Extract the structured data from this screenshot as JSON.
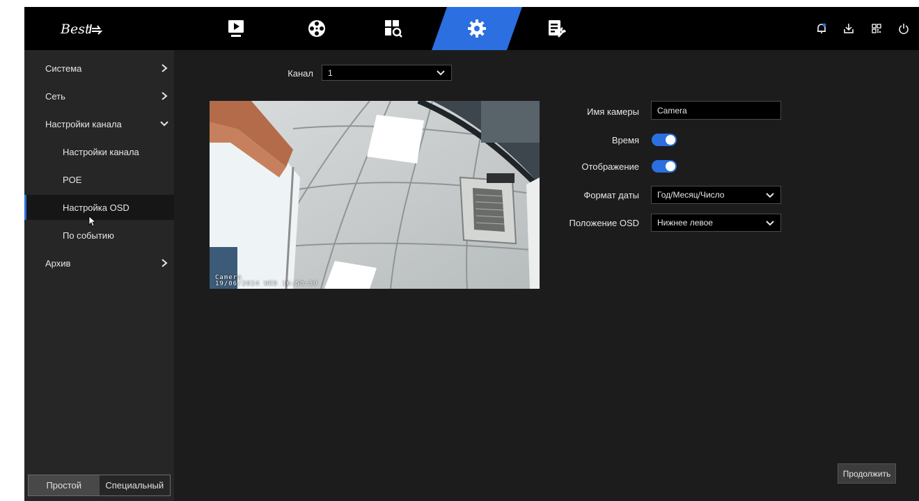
{
  "brand": {
    "logo_text": "Best"
  },
  "topnav": {
    "items": [
      {
        "name": "playback",
        "icon": "play-icon"
      },
      {
        "name": "camera",
        "icon": "film-reel-icon"
      },
      {
        "name": "search",
        "icon": "grid-search-icon"
      },
      {
        "name": "settings",
        "icon": "gear-icon",
        "active": true
      },
      {
        "name": "maintenance",
        "icon": "document-wrench-icon"
      }
    ],
    "right_icons": [
      "alarm-bell-icon",
      "download-icon",
      "qr-code-icon",
      "power-icon"
    ],
    "accent_color": "#2b6fe0"
  },
  "sidebar": {
    "items": [
      {
        "label": "Система",
        "level": 1,
        "expanded": false
      },
      {
        "label": "Сеть",
        "level": 1,
        "expanded": false
      },
      {
        "label": "Настройки канала",
        "level": 1,
        "expanded": true
      },
      {
        "label": "Настройки канала",
        "level": 2
      },
      {
        "label": "POE",
        "level": 2
      },
      {
        "label": "Настройка OSD",
        "level": 2,
        "active": true
      },
      {
        "label": "По событию",
        "level": 2
      },
      {
        "label": "Архив",
        "level": 1,
        "expanded": false
      }
    ],
    "mode": {
      "simple": "Простой",
      "advanced": "Специальный",
      "selected": "simple"
    }
  },
  "main": {
    "channel": {
      "label": "Канал",
      "value": "1"
    },
    "preview": {
      "osd_name": "Camera",
      "osd_datetime": "19/06/2024 WED 16:50:59"
    },
    "form": {
      "camera_name": {
        "label": "Имя камеры",
        "value": "Camera"
      },
      "time": {
        "label": "Время",
        "enabled": true
      },
      "display": {
        "label": "Отображение",
        "enabled": true
      },
      "date_format": {
        "label": "Формат даты",
        "value": "Год/Месяц/Число"
      },
      "osd_position": {
        "label": "Положение OSD",
        "value": "Нижнее левое"
      }
    },
    "continue_label": "Продолжить"
  }
}
